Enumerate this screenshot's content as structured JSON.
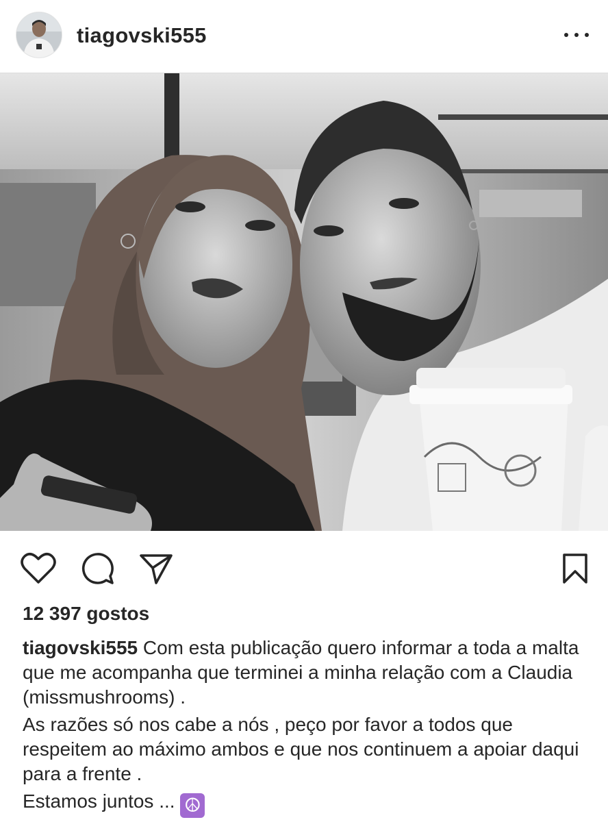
{
  "post": {
    "username": "tiagovski555",
    "more_icon": "more-horizontal-icon",
    "likes_text": "12 397 gostos",
    "caption_paragraphs": [
      "Com esta publicação quero informar a toda a malta que me acompanha que terminei a minha relação com a Claudia (missmushrooms) .",
      "As razões só nos cabe a nós , peço por favor a todos que respeitem ao máximo ambos e que nos continuem a apoiar daqui para a frente .",
      "Estamos juntos ..."
    ],
    "emoji": "☮",
    "actions": [
      "heart-icon",
      "comment-icon",
      "share-icon",
      "bookmark-icon"
    ]
  },
  "colors": {
    "text": "#262626",
    "divider": "#dbdbdb",
    "emoji_bg": "#a16ad1"
  }
}
